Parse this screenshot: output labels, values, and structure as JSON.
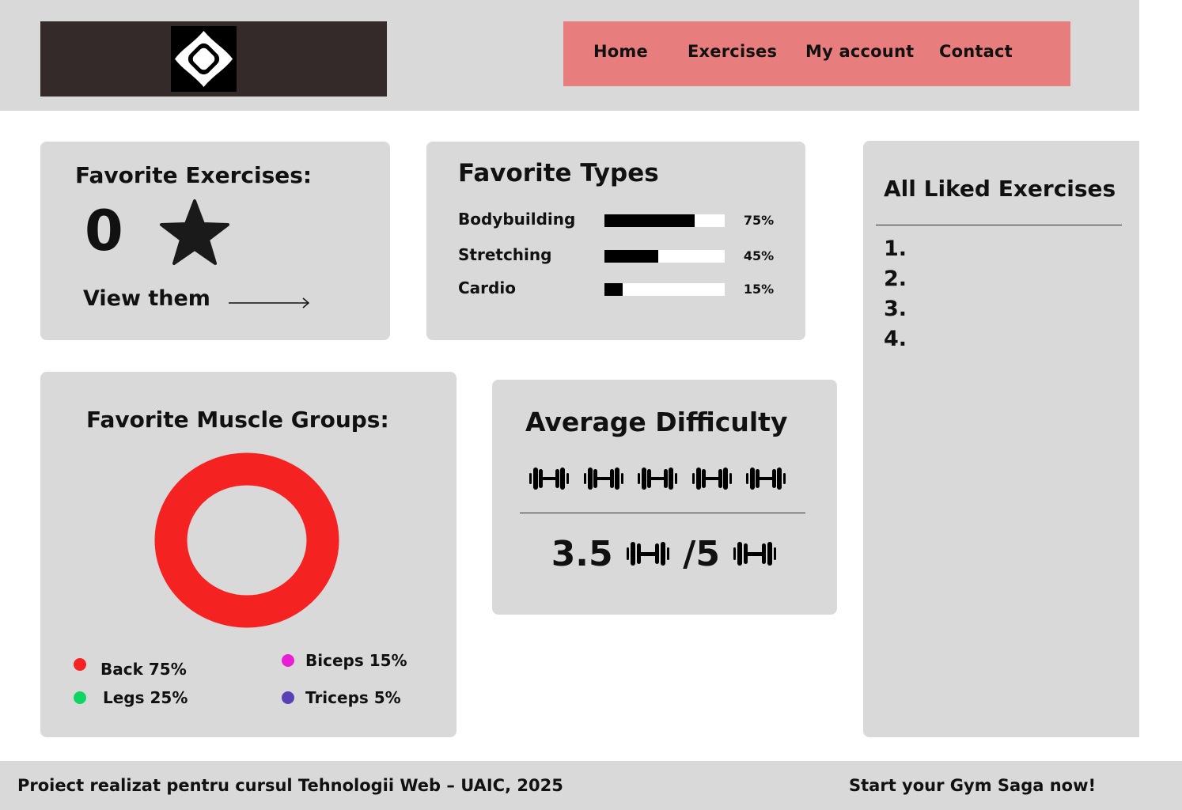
{
  "nav": {
    "items": [
      {
        "label": "Home"
      },
      {
        "label": "Exercises"
      },
      {
        "label": "My account"
      },
      {
        "label": "Contact"
      }
    ]
  },
  "favorites": {
    "title": "Favorite Exercises:",
    "count": "0",
    "view_label": "View them",
    "icon": "star-icon"
  },
  "types": {
    "title": "Favorite Types",
    "items": [
      {
        "name": "Bodybuilding",
        "percent": 75,
        "label": "75%"
      },
      {
        "name": "Stretching",
        "percent": 45,
        "label": "45%"
      },
      {
        "name": "Cardio",
        "percent": 15,
        "label": "15%"
      }
    ]
  },
  "liked": {
    "title": "All Liked Exercises",
    "items": [
      "1.",
      "2.",
      "3.",
      "4."
    ]
  },
  "muscles": {
    "title": "Favorite Muscle Groups:",
    "ring_color": "#f52222",
    "legend": [
      {
        "label": "Back 75%",
        "color": "#f52222"
      },
      {
        "label": "Legs 25%",
        "color": "#0fd663"
      },
      {
        "label": "Biceps 15%",
        "color": "#e81ed4"
      },
      {
        "label": "Triceps 5%",
        "color": "#5a40b5"
      }
    ]
  },
  "difficulty": {
    "title": "Average Difficulty",
    "icon": "dumbbell-icon",
    "dumbbell_count": 5,
    "score": "3.5",
    "max": "/5"
  },
  "footer": {
    "left": "Proiect realizat pentru cursul Tehnologii Web – UAIC, 2025",
    "right": "Start your Gym Saga now!"
  },
  "colors": {
    "header_bg": "#d9d9d9",
    "logo_bg": "#342a2a",
    "nav_bg": "#e87d7d",
    "card_bg": "#d9d9d9"
  }
}
